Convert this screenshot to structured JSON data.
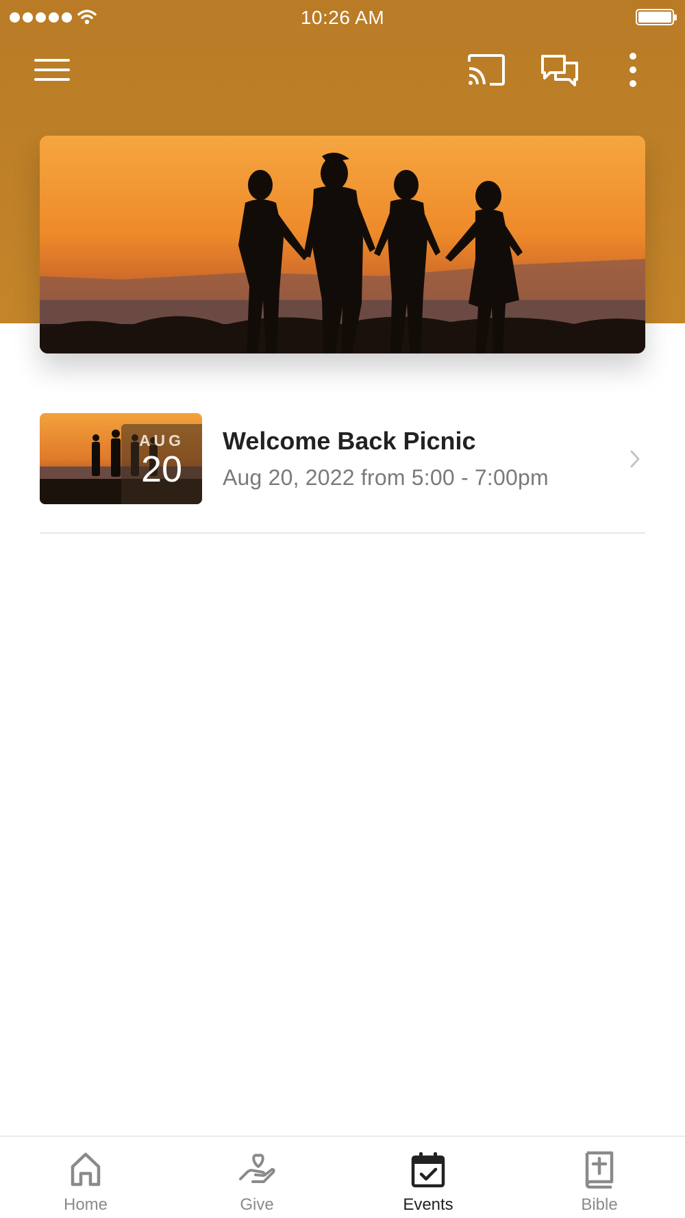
{
  "status_bar": {
    "time": "10:26 AM"
  },
  "toolbar": {
    "menu_icon": "hamburger-menu-icon",
    "cast_icon": "cast-icon",
    "chat_icon": "chat-bubbles-icon",
    "more_icon": "more-vertical-icon"
  },
  "colors": {
    "header": "#bd7f27",
    "text_primary": "#222222",
    "text_secondary": "#7a7a7a",
    "tab_inactive": "#8a8a8a"
  },
  "hero": {
    "image": "family silhouette at sunset"
  },
  "events": [
    {
      "month": "AUG",
      "day": "20",
      "title": "Welcome Back Picnic",
      "subtitle": "Aug 20, 2022 from 5:00 - 7:00pm"
    }
  ],
  "tabs": [
    {
      "label": "Home",
      "icon": "home-icon",
      "active": false
    },
    {
      "label": "Give",
      "icon": "give-hand-heart-icon",
      "active": false
    },
    {
      "label": "Events",
      "icon": "calendar-check-icon",
      "active": true
    },
    {
      "label": "Bible",
      "icon": "bible-book-icon",
      "active": false
    }
  ]
}
